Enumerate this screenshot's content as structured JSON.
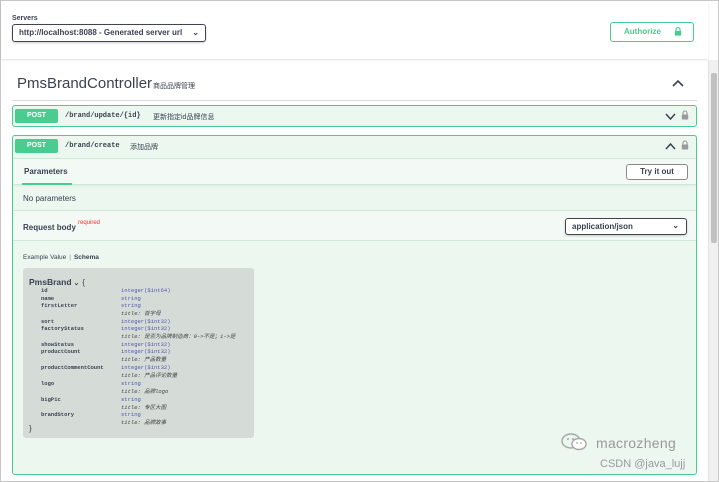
{
  "servers": {
    "label": "Servers",
    "selected": "http://localhost:8088 - Generated server url"
  },
  "authorize": {
    "label": "Authorize",
    "icon": "lock-icon"
  },
  "controller": {
    "title": "PmsBrandController",
    "description": "商品品牌管理"
  },
  "operations": [
    {
      "method": "POST",
      "path": "/brand/update/{id}",
      "description": "更新指定id品牌信息",
      "expanded": false
    },
    {
      "method": "POST",
      "path": "/brand/create",
      "description": "添加品牌",
      "expanded": true,
      "parameters_tab": "Parameters",
      "try_it_out": "Try it out",
      "no_parameters": "No parameters",
      "request_body_label": "Request body",
      "required_label": "required",
      "content_type": "application/json",
      "example_value_tab": "Example Value",
      "schema_tab": "Schema"
    }
  ],
  "schema": {
    "name": "PmsBrand",
    "open_brace": "{",
    "close_brace": "}",
    "properties": [
      {
        "name": "id",
        "type": "integer($int64)"
      },
      {
        "name": "name",
        "type": "string"
      },
      {
        "name": "firstLetter",
        "type": "string",
        "title": "title: 首字母"
      },
      {
        "name": "sort",
        "type": "integer($int32)"
      },
      {
        "name": "factoryStatus",
        "type": "integer($int32)",
        "title": "title: 是否为品牌制造商：0->不是；1->是"
      },
      {
        "name": "showStatus",
        "type": "integer($int32)"
      },
      {
        "name": "productCount",
        "type": "integer($int32)",
        "title": "title: 产品数量"
      },
      {
        "name": "productCommentCount",
        "type": "integer($int32)",
        "title": "title: 产品评论数量"
      },
      {
        "name": "logo",
        "type": "string",
        "title": "title: 品牌logo"
      },
      {
        "name": "bigPic",
        "type": "string",
        "title": "title: 专区大图"
      },
      {
        "name": "brandStory",
        "type": "string",
        "title": "title: 品牌故事"
      }
    ]
  },
  "watermark": {
    "name": "macrozheng",
    "csdn": "CSDN @java_lujj"
  },
  "colors": {
    "post": "#49cc90",
    "post_bg": "#ebf7ef",
    "text": "#3b4151",
    "required": "#ff2d2d"
  }
}
